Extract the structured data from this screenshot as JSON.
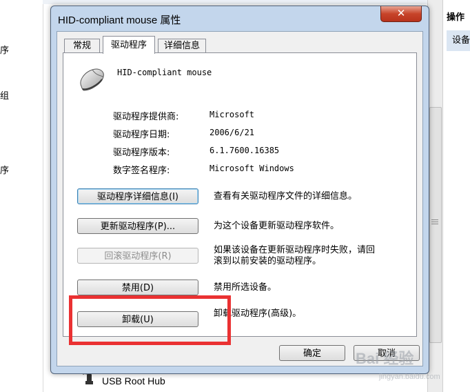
{
  "background": {
    "left_fragments": [
      "序",
      "组",
      "序"
    ],
    "right_header": "操作",
    "right_item": "设备",
    "tree_item_label": "USB Root Hub"
  },
  "dialog": {
    "title": "HID-compliant mouse 属性",
    "close_label": "✕",
    "tabs": [
      {
        "label": "常规",
        "active": false
      },
      {
        "label": "驱动程序",
        "active": true
      },
      {
        "label": "详细信息",
        "active": false
      }
    ],
    "device_name": "HID-compliant mouse",
    "info": [
      {
        "label": "驱动程序提供商:",
        "value": "Microsoft"
      },
      {
        "label": "驱动程序日期:",
        "value": "2006/6/21"
      },
      {
        "label": "驱动程序版本:",
        "value": "6.1.7600.16385"
      },
      {
        "label": "数字签名程序:",
        "value": "Microsoft Windows"
      }
    ],
    "actions": [
      {
        "button": "驱动程序详细信息(I)",
        "description": "查看有关驱动程序文件的详细信息。",
        "enabled": true
      },
      {
        "button": "更新驱动程序(P)...",
        "description": "为这个设备更新驱动程序软件。",
        "enabled": true
      },
      {
        "button": "回滚驱动程序(R)",
        "description": "如果该设备在更新驱动程序时失败，请回滚到以前安装的驱动程序。",
        "description_line1": "如果该设备在更新驱动程序时失败，请回",
        "description_line2": "滚到以前安装的驱动程序。",
        "enabled": false
      },
      {
        "button": "禁用(D)",
        "description": "禁用所选设备。",
        "enabled": true
      },
      {
        "button": "卸载(U)",
        "description": "卸载驱动程序(高级)。",
        "enabled": true
      }
    ],
    "ok_label": "确定",
    "cancel_label": "取消"
  },
  "watermark": {
    "main": "Bai 经验",
    "sub": "jingyan.baidu.com"
  },
  "colors": {
    "highlight": "#ea3132",
    "dialog_frame": "#c3d6ec",
    "close_button": "#c7442a"
  },
  "icons": {
    "device": "mouse-icon",
    "tree_item": "usb-icon",
    "close": "close-icon"
  }
}
